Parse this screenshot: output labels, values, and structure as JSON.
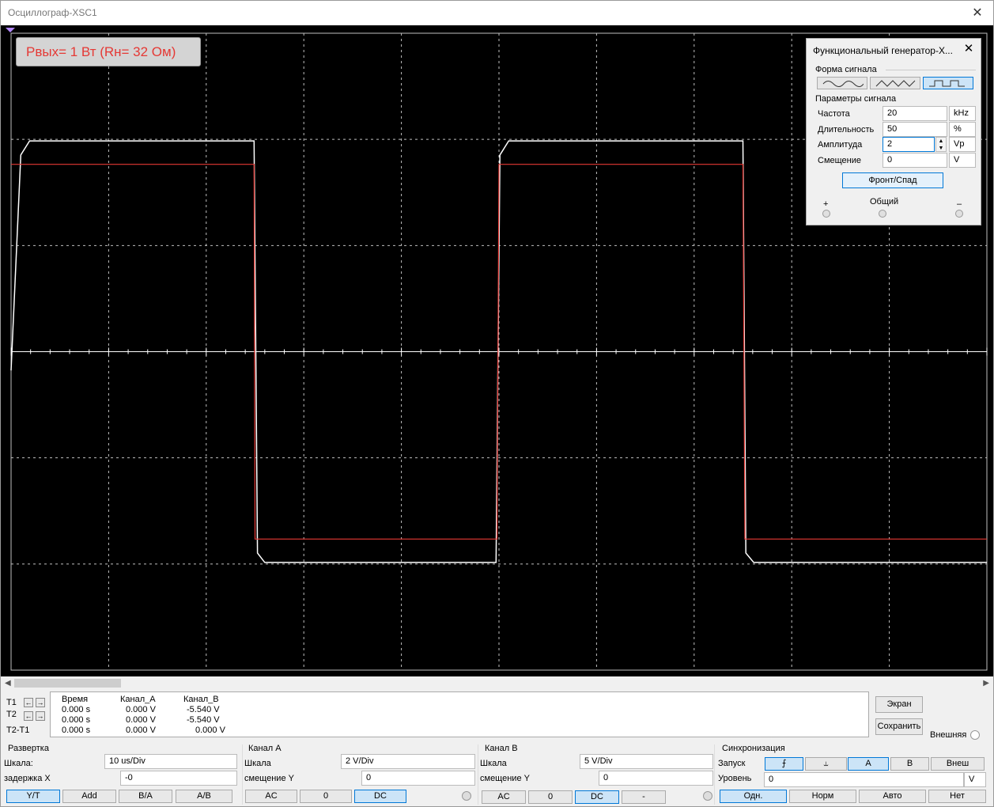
{
  "window": {
    "title": "Осциллограф-XSC1"
  },
  "screen_label": "Рвых= 1 Вт (Rн= 32 Ом)",
  "colors": {
    "background": "#000000",
    "grid": "#bfbfbf",
    "channel_a": "#ffffff",
    "channel_b": "#e53935",
    "label_text": "#e53935"
  },
  "chart_data": {
    "type": "line",
    "title": "",
    "grid": true,
    "xlabel": "",
    "ylabel": "",
    "x_divisions": 10,
    "y_divisions": 6,
    "series": [
      {
        "name": "Канал_A",
        "points": [
          [
            0,
            -0.4
          ],
          [
            0.2,
            4.2
          ],
          [
            0.2,
            4.2
          ],
          [
            0.38,
            4.5
          ],
          [
            4.98,
            4.5
          ],
          [
            5.05,
            -4.3
          ],
          [
            5.2,
            -4.5
          ],
          [
            9.94,
            -4.5
          ],
          [
            10.02,
            4.2
          ],
          [
            10.2,
            4.5
          ],
          [
            15.0,
            4.5
          ],
          [
            15.06,
            -4.3
          ],
          [
            15.22,
            -4.5
          ],
          [
            20,
            -4.5
          ]
        ]
      },
      {
        "name": "Канал_B",
        "points": [
          [
            0,
            4.0
          ],
          [
            4.98,
            4.0
          ],
          [
            5.0,
            -4.0
          ],
          [
            9.96,
            -4.0
          ],
          [
            10.0,
            4.0
          ],
          [
            15.0,
            4.0
          ],
          [
            15.04,
            -4.0
          ],
          [
            20,
            -4.0
          ]
        ]
      }
    ]
  },
  "func_gen": {
    "title": "Функциональный генератор-X...",
    "waveform_label": "Форма сигнала",
    "params_label": "Параметры сигнала",
    "rows": [
      {
        "label": "Частота",
        "value": "20",
        "unit": "kHz"
      },
      {
        "label": "Длительность",
        "value": "50",
        "unit": "%"
      },
      {
        "label": "Амплитуда",
        "value": "2",
        "unit": "Vp"
      },
      {
        "label": "Смещение",
        "value": "0",
        "unit": "V"
      }
    ],
    "rise_fall_label": "Фронт/Спад",
    "terminals": {
      "plus": "+",
      "common": "Общий",
      "minus": "–"
    }
  },
  "cursors": {
    "rows": [
      "T1",
      "T2",
      "T2-T1"
    ],
    "headers": [
      "Время",
      "Канал_A",
      "Канал_B"
    ],
    "values": [
      [
        "0.000 s",
        "0.000 V",
        "-5.540 V"
      ],
      [
        "0.000 s",
        "0.000 V",
        "-5.540 V"
      ],
      [
        "0.000 s",
        "0.000 V",
        "0.000 V"
      ]
    ],
    "screen_btn": "Экран",
    "save_btn": "Сохранить",
    "external_label": "Внешняя"
  },
  "timebase": {
    "title": "Развертка",
    "scale_label": "Шкала:",
    "scale_value": "10 us/Div",
    "delay_label": "задержка X",
    "delay_value": "-0",
    "modes": [
      "Y/T",
      "Add",
      "B/A",
      "A/B"
    ]
  },
  "channel_a": {
    "title": "Канал А",
    "scale_label": "Шкала",
    "scale_value": "2  V/Div",
    "offset_label": "смещение Y",
    "offset_value": "0",
    "coupling": [
      "AC",
      "0",
      "DC"
    ]
  },
  "channel_b": {
    "title": "Канал В",
    "scale_label": "Шкала",
    "scale_value": "5  V/Div",
    "offset_label": "смещение Y",
    "offset_value": "0",
    "coupling": [
      "AC",
      "0",
      "DC",
      "-"
    ]
  },
  "trigger": {
    "title": "Синхронизация",
    "start_label": "Запуск",
    "edge_rise": "⨍",
    "edge_fall": "⥿",
    "sources": [
      "A",
      "B",
      "Внеш"
    ],
    "level_label": "Уровень",
    "level_value": "0",
    "level_unit": "V",
    "modes": [
      "Одн.",
      "Норм",
      "Авто",
      "Нет"
    ]
  }
}
